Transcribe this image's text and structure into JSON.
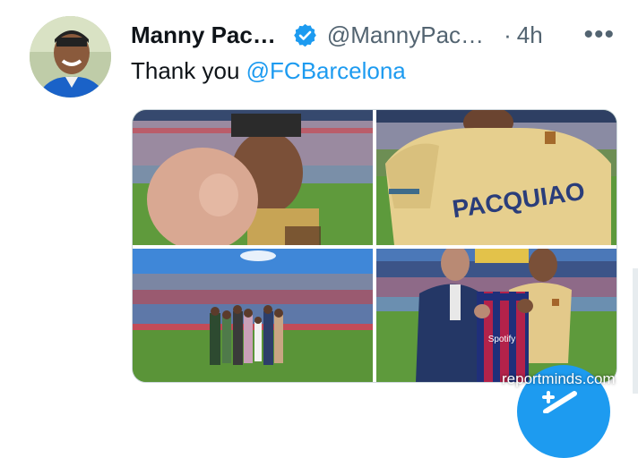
{
  "tweet": {
    "author_name": "Manny Pac…",
    "handle": "@MannyPac…",
    "separator": "·",
    "time": "4h",
    "more": "•••",
    "text_prefix": "Thank you ",
    "mention": "@FCBarcelona"
  },
  "photos": [
    {
      "label": "Fist to camera in stadium"
    },
    {
      "label": "Back of yellow jersey"
    },
    {
      "label": "Group photo on pitch"
    },
    {
      "label": "Jersey presentation"
    }
  ],
  "jersey_text": "PACQUIAO",
  "sponsor_text": "Spotify",
  "watermark": "reportminds.com",
  "colors": {
    "accent": "#1d9bf0",
    "text": "#0f1419",
    "muted": "#536471"
  },
  "icons": [
    "verified-badge-icon",
    "more-icon",
    "compose-icon"
  ]
}
